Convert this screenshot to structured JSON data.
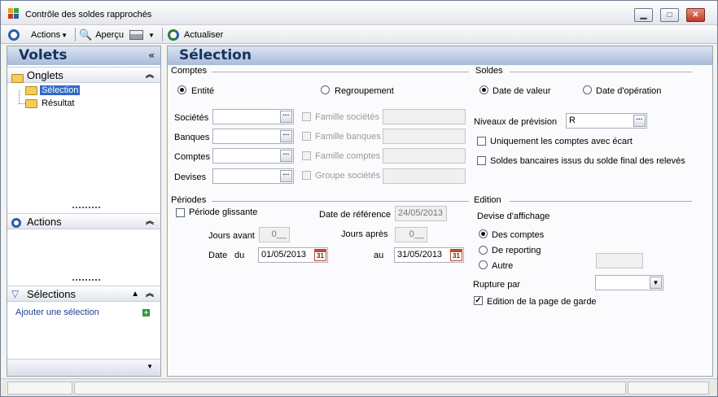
{
  "window": {
    "title": "Contrôle des soldes rapprochés",
    "controls": {
      "minimize": "▁",
      "maximize": "□",
      "close": "✕"
    }
  },
  "toolbar": {
    "actions_label": "Actions",
    "preview_label": "Aperçu",
    "refresh_label": "Actualiser"
  },
  "left": {
    "title": "Volets",
    "collapse": "«",
    "tabs_section": {
      "title": "Onglets",
      "items": [
        {
          "label": "Sélection",
          "selected": true
        },
        {
          "label": "Résultat",
          "selected": false
        }
      ]
    },
    "actions_section": {
      "title": "Actions"
    },
    "selections_section": {
      "title": "Sélections",
      "add_label": "Ajouter une sélection"
    }
  },
  "main": {
    "title": "Sélection",
    "comptes": {
      "title": "Comptes",
      "radio_entite": "Entité",
      "radio_regroupement": "Regroupement",
      "selected": "entite",
      "fields": [
        {
          "label": "Sociétés",
          "value": "",
          "family_label": "Famille sociétés",
          "family_value": ""
        },
        {
          "label": "Banques",
          "value": "",
          "family_label": "Famille banques",
          "family_value": ""
        },
        {
          "label": "Comptes",
          "value": "",
          "family_label": "Famille comptes",
          "family_value": ""
        },
        {
          "label": "Devises",
          "value": "",
          "family_label": "Groupe sociétés",
          "family_value": ""
        }
      ]
    },
    "soldes": {
      "title": "Soldes",
      "radio_valeur": "Date de valeur",
      "radio_operation": "Date d'opération",
      "selected": "valeur",
      "niveaux_label": "Niveaux de prévision",
      "niveaux_value": "R",
      "check_ecart": "Uniquement les comptes avec écart",
      "check_ecart_checked": false,
      "check_bancaires": "Soldes bancaires issus du solde final des relevés",
      "check_bancaires_checked": false
    },
    "periodes": {
      "title": "Périodes",
      "glissante_label": "Période glissante",
      "glissante_checked": false,
      "date_ref_label": "Date de référence",
      "date_ref_value": "24/05/2013",
      "jours_avant_label": "Jours avant",
      "jours_avant_value": "0__",
      "jours_apres_label": "Jours après",
      "jours_apres_value": "0__",
      "date_label": "Date",
      "du_label": "du",
      "du_value": "01/05/2013",
      "au_label": "au",
      "au_value": "31/05/2013",
      "calendar_day": "31"
    },
    "edition": {
      "title": "Edition",
      "devise_label": "Devise d'affichage",
      "radio_comptes": "Des comptes",
      "radio_reporting": "De reporting",
      "radio_autre": "Autre",
      "selected": "comptes",
      "autre_value": "",
      "rupture_label": "Rupture par",
      "rupture_value": "",
      "page_garde_label": "Edition de la page de garde",
      "page_garde_checked": true
    }
  }
}
